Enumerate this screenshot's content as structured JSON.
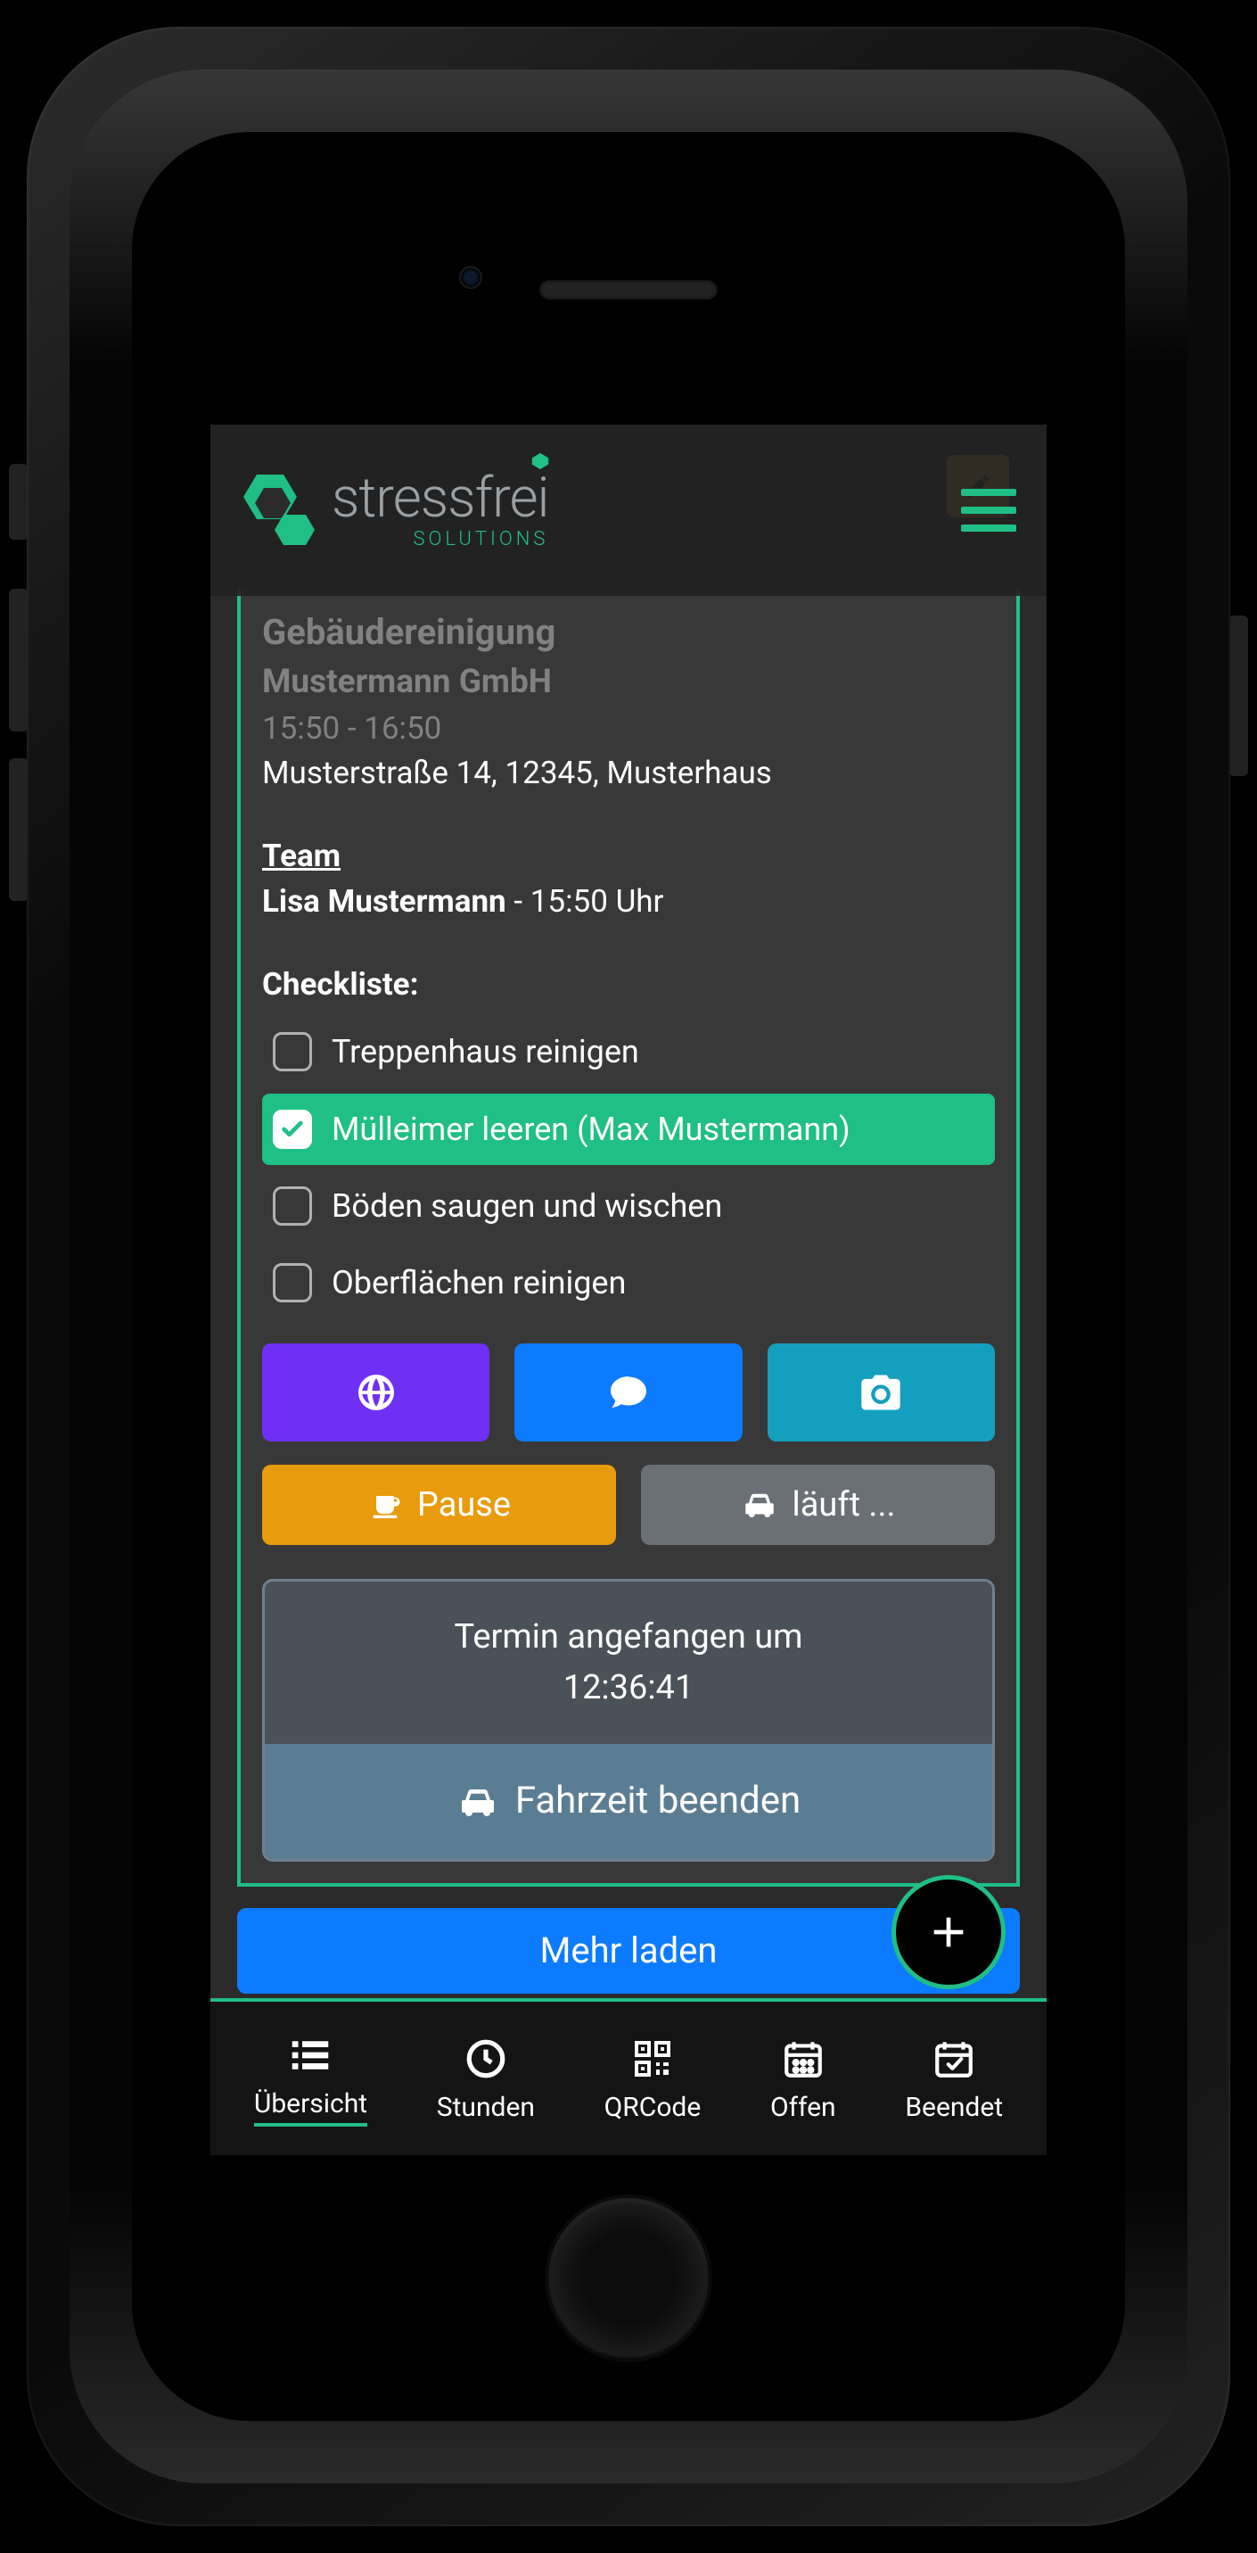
{
  "brand": {
    "name": "stressfrei",
    "sub": "SOLUTIONS"
  },
  "card": {
    "title": "Gebäudereinigung",
    "company": "Mustermann GmbH",
    "time_range": "15:50 - 16:50",
    "address": "Musterstraße 14, 12345, Musterhaus",
    "team_label": "Team",
    "team_member": "Lisa Mustermann",
    "team_time": "15:50 Uhr",
    "checklist_label": "Checkliste:",
    "checklist": [
      {
        "label": "Treppenhaus reinigen",
        "checked": false
      },
      {
        "label": "Mülleimer leeren (Max Mustermann)",
        "checked": true
      },
      {
        "label": "Böden saugen und wischen",
        "checked": false
      },
      {
        "label": "Oberflächen reinigen",
        "checked": false
      }
    ],
    "pause_label": "Pause",
    "running_label": "läuft ...",
    "status_line1": "Termin angefangen um",
    "status_line2": "12:36:41",
    "end_drive_label": "Fahrzeit beenden"
  },
  "load_more": "Mehr laden",
  "nav": {
    "overview": "Übersicht",
    "hours": "Stunden",
    "qrcode": "QRCode",
    "open": "Offen",
    "done": "Beendet"
  }
}
